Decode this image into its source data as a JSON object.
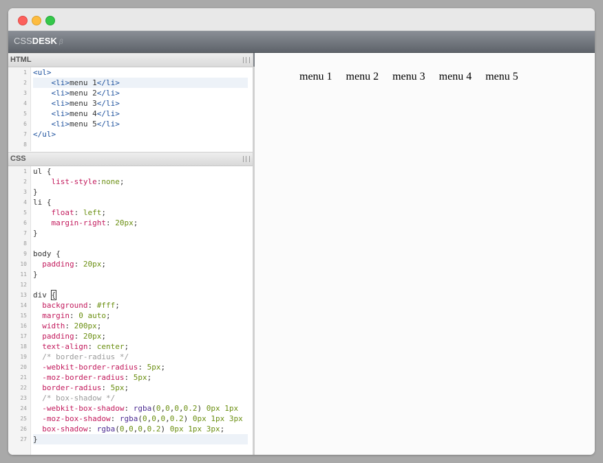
{
  "app": {
    "logo_css": "CSS",
    "logo_desk": "DESK",
    "logo_version": "β"
  },
  "html_pane": {
    "title": "HTML",
    "lines": [
      {
        "n": "1",
        "tokens": [
          [
            "tag",
            "<ul>"
          ]
        ]
      },
      {
        "n": "2",
        "tokens": [
          [
            "plain",
            "    "
          ],
          [
            "tag",
            "<li>"
          ],
          [
            "plain",
            "menu 1"
          ],
          [
            "tag",
            "</li>"
          ]
        ]
      },
      {
        "n": "3",
        "tokens": [
          [
            "plain",
            "    "
          ],
          [
            "tag",
            "<li>"
          ],
          [
            "plain",
            "menu 2"
          ],
          [
            "tag",
            "</li>"
          ]
        ]
      },
      {
        "n": "4",
        "tokens": [
          [
            "plain",
            "    "
          ],
          [
            "tag",
            "<li>"
          ],
          [
            "plain",
            "menu 3"
          ],
          [
            "tag",
            "</li>"
          ]
        ]
      },
      {
        "n": "5",
        "tokens": [
          [
            "plain",
            "    "
          ],
          [
            "tag",
            "<li>"
          ],
          [
            "plain",
            "menu 4"
          ],
          [
            "tag",
            "</li>"
          ]
        ]
      },
      {
        "n": "6",
        "tokens": [
          [
            "plain",
            "    "
          ],
          [
            "tag",
            "<li>"
          ],
          [
            "plain",
            "menu 5"
          ],
          [
            "tag",
            "</li>"
          ]
        ]
      },
      {
        "n": "7",
        "tokens": [
          [
            "tag",
            "</ul>"
          ]
        ]
      },
      {
        "n": "8",
        "tokens": []
      }
    ],
    "active_line": "2"
  },
  "css_pane": {
    "title": "CSS",
    "lines": [
      {
        "n": "1",
        "tokens": [
          [
            "plain",
            "ul {"
          ]
        ]
      },
      {
        "n": "2",
        "tokens": [
          [
            "plain",
            "    "
          ],
          [
            "prop",
            "list-style"
          ],
          [
            "plain",
            ":"
          ],
          [
            "val",
            "none"
          ],
          [
            "plain",
            ";"
          ]
        ]
      },
      {
        "n": "3",
        "tokens": [
          [
            "plain",
            "}"
          ]
        ]
      },
      {
        "n": "4",
        "tokens": [
          [
            "plain",
            "li {"
          ]
        ]
      },
      {
        "n": "5",
        "tokens": [
          [
            "plain",
            "    "
          ],
          [
            "prop",
            "float"
          ],
          [
            "plain",
            ": "
          ],
          [
            "val",
            "left"
          ],
          [
            "plain",
            ";"
          ]
        ]
      },
      {
        "n": "6",
        "tokens": [
          [
            "plain",
            "    "
          ],
          [
            "prop",
            "margin-right"
          ],
          [
            "plain",
            ": "
          ],
          [
            "val",
            "20px"
          ],
          [
            "plain",
            ";"
          ]
        ]
      },
      {
        "n": "7",
        "tokens": [
          [
            "plain",
            "}"
          ]
        ]
      },
      {
        "n": "8",
        "tokens": []
      },
      {
        "n": "9",
        "tokens": [
          [
            "plain",
            "body {"
          ]
        ]
      },
      {
        "n": "10",
        "tokens": [
          [
            "plain",
            "  "
          ],
          [
            "prop",
            "padding"
          ],
          [
            "plain",
            ": "
          ],
          [
            "val",
            "20px"
          ],
          [
            "plain",
            ";"
          ]
        ]
      },
      {
        "n": "11",
        "tokens": [
          [
            "plain",
            "}"
          ]
        ]
      },
      {
        "n": "12",
        "tokens": []
      },
      {
        "n": "13",
        "tokens": [
          [
            "plain",
            "div "
          ],
          [
            "brace",
            "{"
          ]
        ]
      },
      {
        "n": "14",
        "tokens": [
          [
            "plain",
            "  "
          ],
          [
            "prop",
            "background"
          ],
          [
            "plain",
            ": "
          ],
          [
            "val",
            "#fff"
          ],
          [
            "plain",
            ";"
          ]
        ]
      },
      {
        "n": "15",
        "tokens": [
          [
            "plain",
            "  "
          ],
          [
            "prop",
            "margin"
          ],
          [
            "plain",
            ": "
          ],
          [
            "val",
            "0 auto"
          ],
          [
            "plain",
            ";"
          ]
        ]
      },
      {
        "n": "16",
        "tokens": [
          [
            "plain",
            "  "
          ],
          [
            "prop",
            "width"
          ],
          [
            "plain",
            ": "
          ],
          [
            "val",
            "200px"
          ],
          [
            "plain",
            ";"
          ]
        ]
      },
      {
        "n": "17",
        "tokens": [
          [
            "plain",
            "  "
          ],
          [
            "prop",
            "padding"
          ],
          [
            "plain",
            ": "
          ],
          [
            "val",
            "20px"
          ],
          [
            "plain",
            ";"
          ]
        ]
      },
      {
        "n": "18",
        "tokens": [
          [
            "plain",
            "  "
          ],
          [
            "prop",
            "text-align"
          ],
          [
            "plain",
            ": "
          ],
          [
            "val",
            "center"
          ],
          [
            "plain",
            ";"
          ]
        ]
      },
      {
        "n": "19",
        "tokens": [
          [
            "plain",
            "  "
          ],
          [
            "comment",
            "/* border-radius */"
          ]
        ]
      },
      {
        "n": "20",
        "tokens": [
          [
            "plain",
            "  "
          ],
          [
            "prop",
            "-webkit-border-radius"
          ],
          [
            "plain",
            ": "
          ],
          [
            "val",
            "5px"
          ],
          [
            "plain",
            ";"
          ]
        ]
      },
      {
        "n": "21",
        "tokens": [
          [
            "plain",
            "  "
          ],
          [
            "prop",
            "-moz-border-radius"
          ],
          [
            "plain",
            ": "
          ],
          [
            "val",
            "5px"
          ],
          [
            "plain",
            ";"
          ]
        ]
      },
      {
        "n": "22",
        "tokens": [
          [
            "plain",
            "  "
          ],
          [
            "prop",
            "border-radius"
          ],
          [
            "plain",
            ": "
          ],
          [
            "val",
            "5px"
          ],
          [
            "plain",
            ";"
          ]
        ]
      },
      {
        "n": "23",
        "tokens": [
          [
            "plain",
            "  "
          ],
          [
            "comment",
            "/* box-shadow */"
          ]
        ]
      },
      {
        "n": "24",
        "tokens": [
          [
            "plain",
            "  "
          ],
          [
            "prop",
            "-webkit-box-shadow"
          ],
          [
            "plain",
            ": "
          ],
          [
            "fn",
            "rgba"
          ],
          [
            "plain",
            "("
          ],
          [
            "val",
            "0"
          ],
          [
            "plain",
            ","
          ],
          [
            "val",
            "0"
          ],
          [
            "plain",
            ","
          ],
          [
            "val",
            "0"
          ],
          [
            "plain",
            ","
          ],
          [
            "val",
            "0.2"
          ],
          [
            "plain",
            ") "
          ],
          [
            "val",
            "0px"
          ],
          [
            "plain",
            " "
          ],
          [
            "val",
            "1px"
          ]
        ]
      },
      {
        "n": "25",
        "tokens": [
          [
            "plain",
            "  "
          ],
          [
            "prop",
            "-moz-box-shadow"
          ],
          [
            "plain",
            ": "
          ],
          [
            "fn",
            "rgba"
          ],
          [
            "plain",
            "("
          ],
          [
            "val",
            "0"
          ],
          [
            "plain",
            ","
          ],
          [
            "val",
            "0"
          ],
          [
            "plain",
            ","
          ],
          [
            "val",
            "0"
          ],
          [
            "plain",
            ","
          ],
          [
            "val",
            "0.2"
          ],
          [
            "plain",
            ") "
          ],
          [
            "val",
            "0px"
          ],
          [
            "plain",
            " "
          ],
          [
            "val",
            "1px"
          ],
          [
            "plain",
            " "
          ],
          [
            "val",
            "3px"
          ]
        ]
      },
      {
        "n": "26",
        "tokens": [
          [
            "plain",
            "  "
          ],
          [
            "prop",
            "box-shadow"
          ],
          [
            "plain",
            ": "
          ],
          [
            "fn",
            "rgba"
          ],
          [
            "plain",
            "("
          ],
          [
            "val",
            "0"
          ],
          [
            "plain",
            ","
          ],
          [
            "val",
            "0"
          ],
          [
            "plain",
            ","
          ],
          [
            "val",
            "0"
          ],
          [
            "plain",
            ","
          ],
          [
            "val",
            "0.2"
          ],
          [
            "plain",
            ") "
          ],
          [
            "val",
            "0px"
          ],
          [
            "plain",
            " "
          ],
          [
            "val",
            "1px"
          ],
          [
            "plain",
            " "
          ],
          [
            "val",
            "3px"
          ],
          [
            "plain",
            ";"
          ]
        ]
      },
      {
        "n": "27",
        "tokens": [
          [
            "plain",
            "}"
          ]
        ]
      }
    ],
    "active_line": "27"
  },
  "preview": {
    "menu_items": [
      "menu 1",
      "menu 2",
      "menu 3",
      "menu 4",
      "menu 5"
    ]
  },
  "colors": {
    "tag": "#1a4f9c",
    "property": "#c2185b",
    "value": "#6a8e10",
    "function": "#4b2a91",
    "comment": "#9a9a9a",
    "active_line": "#edf2f8"
  }
}
